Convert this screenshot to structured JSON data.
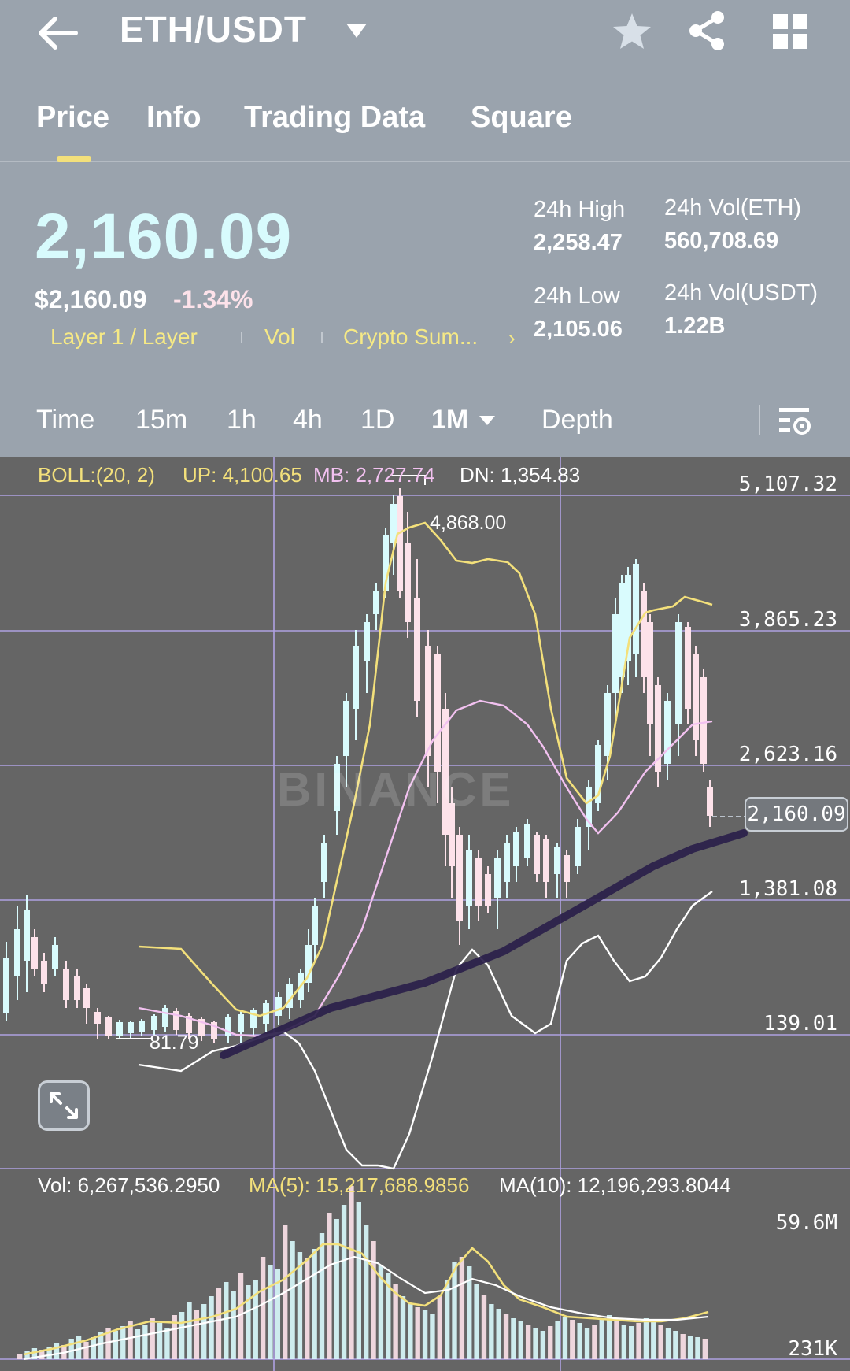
{
  "header": {
    "pair": "ETH/USDT",
    "icons": [
      "back-arrow-icon",
      "caret-down-icon",
      "star-icon",
      "share-icon",
      "grid-icon"
    ]
  },
  "tabs": [
    {
      "label": "Price",
      "active": true
    },
    {
      "label": "Info"
    },
    {
      "label": "Trading Data"
    },
    {
      "label": "Square"
    }
  ],
  "ticker": {
    "last_price": "2,160.09",
    "usd_price": "$2,160.09",
    "change_pct": "-1.34%",
    "tags": [
      "Layer 1 / Layer",
      "Vol",
      "Crypto Sum..."
    ],
    "high_label": "24h High",
    "high_value": "2,258.47",
    "low_label": "24h Low",
    "low_value": "2,105.06",
    "vol_eth_label": "24h Vol(ETH)",
    "vol_eth_value": "560,708.69",
    "vol_usdt_label": "24h Vol(USDT)",
    "vol_usdt_value": "1.22B"
  },
  "intervals": [
    {
      "label": "Time"
    },
    {
      "label": "15m"
    },
    {
      "label": "1h"
    },
    {
      "label": "4h"
    },
    {
      "label": "1D"
    },
    {
      "label": "1M",
      "active": true
    },
    {
      "label": "Depth"
    }
  ],
  "indicators": {
    "boll_label": "BOLL:(20, 2)",
    "boll_up": "UP: 4,100.65",
    "boll_mb": "MB: 2,727.74",
    "boll_dn": "DN: 1,354.83",
    "vol": "Vol: 6,267,536.2950",
    "ma5": "MA(5): 15,217,688.9856",
    "ma10": "MA(10): 12,196,293.8044"
  },
  "price_axis": [
    "5,107.32",
    "3,865.23",
    "2,623.16",
    "1,381.08",
    "139.01"
  ],
  "volume_axis": [
    "59.6M",
    "231K"
  ],
  "current_price_tag": "2,160.09",
  "high_marker": "4,868.00",
  "low_marker": "81.79",
  "watermark": "BINANCE",
  "colors": {
    "background": "#9aa3ad",
    "chart_background": "#656565",
    "price_text": "#d8fbfd",
    "accent_yellow": "#f3e07b",
    "up_candle": "#d9fbfd",
    "down_candle": "#fde2ea",
    "mid_band": "#f2c1f0",
    "trendline": "#2a1f4a"
  },
  "chart_data": {
    "type": "candlestick",
    "interval": "1M",
    "y_axis_ticks": [
      5107.32,
      3865.23,
      2623.16,
      1381.08,
      139.01
    ],
    "ylim": [
      139.01,
      5107.32
    ],
    "last_price": 2160.09,
    "period_high": 4868.0,
    "period_low": 81.79,
    "bollinger": {
      "period": 20,
      "k": 2,
      "up": 4100.65,
      "mb": 2727.74,
      "dn": 1354.83
    },
    "volume": {
      "last": 6267536.295,
      "ma5": 15217688.9856,
      "ma10": 12196293.8044,
      "axis_max": "59.6M",
      "axis_min": "231K"
    }
  }
}
